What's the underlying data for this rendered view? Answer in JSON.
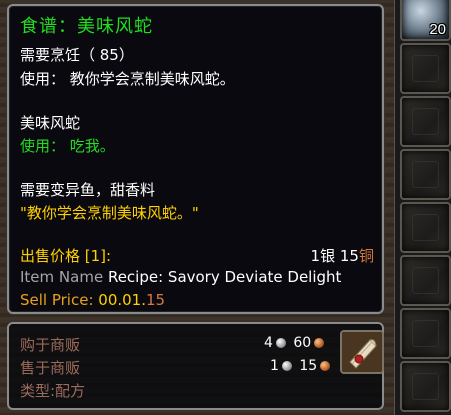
{
  "bag": {
    "top_item_count": "20"
  },
  "tooltip": {
    "title": "食谱：美味风蛇",
    "requires": "需要烹饪（ 85）",
    "use_line": "使用：  教你学会烹制美味风蛇。",
    "item_name_cn": "美味风蛇",
    "use_eat": "使用：  吃我。",
    "reagents": "需要变异鱼，甜香料",
    "flavor": "\"教你学会烹制美味风蛇。\"",
    "sell_label_cn": "出售价格 [1]:",
    "sell_silver_value": "1",
    "sell_silver_unit": "银",
    "sell_copper_value": "15",
    "sell_copper_unit": "铜",
    "item_name_label": "Item Name",
    "item_name_en": "Recipe: Savory Deviate Delight",
    "sell_price_label": "Sell Price:",
    "sell_price_gold_silver": "00.01.",
    "sell_price_copper": "15"
  },
  "vendor": {
    "buy_label": "购于商贩",
    "buy_silver": "4",
    "buy_copper": "60",
    "sell_label": "售于商贩",
    "sell_silver": "1",
    "sell_copper": "15",
    "type_label": "类型:配方"
  },
  "colors": {
    "title_green": "#20dd1f",
    "gold_text": "#ffd100",
    "copper_text": "#d7793a"
  }
}
